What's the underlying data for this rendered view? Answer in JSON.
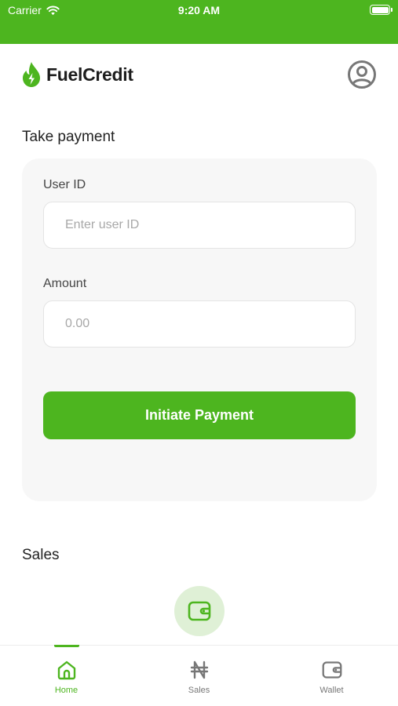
{
  "status_bar": {
    "carrier": "Carrier",
    "time": "9:20 AM"
  },
  "header": {
    "brand": "FuelCredit"
  },
  "take_payment": {
    "title": "Take payment",
    "user_id": {
      "label": "User ID",
      "placeholder": "Enter user ID",
      "value": ""
    },
    "amount": {
      "label": "Amount",
      "placeholder": "0.00",
      "value": ""
    },
    "submit_label": "Initiate Payment"
  },
  "sales": {
    "title": "Sales"
  },
  "tabs": [
    {
      "label": "Home",
      "icon": "home-icon",
      "active": true
    },
    {
      "label": "Sales",
      "icon": "naira-icon",
      "active": false
    },
    {
      "label": "Wallet",
      "icon": "wallet-icon",
      "active": false
    }
  ],
  "colors": {
    "brand": "#4db51f",
    "card_bg": "#f7f7f7",
    "fab_bg": "#dff0d6"
  }
}
